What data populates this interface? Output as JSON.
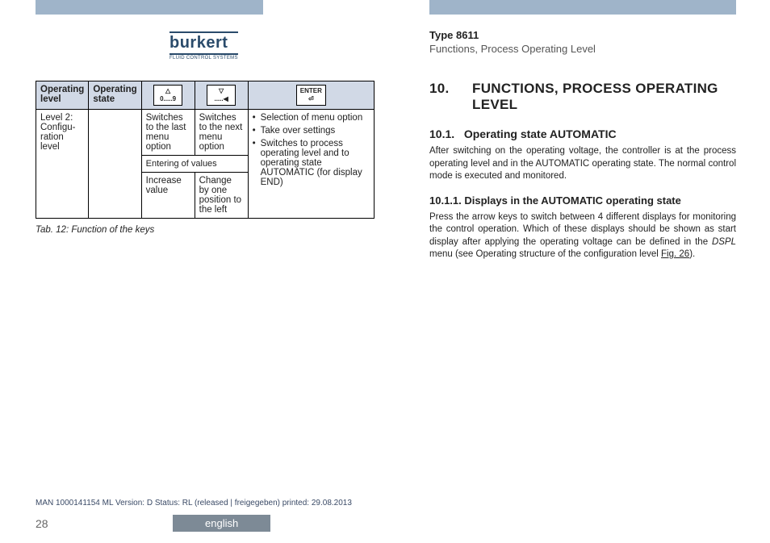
{
  "brand": {
    "name": "burkert",
    "tagline": "FLUID CONTROL SYSTEMS"
  },
  "header": {
    "type": "Type 8611",
    "section": "Functions, Process Operating Level"
  },
  "table": {
    "header": {
      "c0": "Operating level",
      "c1": "Operating state",
      "k1": "△\n0.....9",
      "k2": "▽\n.....◀",
      "k3": "ENTER\n⏎"
    },
    "r0c0": "Level 2: Configu­ration level",
    "r0c1": "",
    "r0c2": "Switches to the last menu option",
    "r0c3": "Switches to the next menu option",
    "r0c4_items": [
      "Selection of menu option",
      "Take over settings",
      "Switches to process operating level and to operating state AUTOMATIC (for display END)"
    ],
    "mid": "Entering of values",
    "r1c2": "Increase value",
    "r1c3": "Change by one position to the left",
    "caption": "Tab. 12:  Function of the keys"
  },
  "right": {
    "num": "10.",
    "title": "FUNCTIONS, PROCESS OPERATING LEVEL",
    "s1num": "10.1.",
    "s1title": "Operating state AUTOMATIC",
    "s1body": "After switching on the operating voltage, the controller is at the process operating level and in the AUTOMATIC operating state. The normal control mode is executed and monitored.",
    "s11num": "10.1.1.",
    "s11title": "Displays in the AUTOMATIC operating state",
    "s11body_a": "Press the arrow keys to switch between 4 different displays for monitoring the control operation. Which of these displays should be shown as start display after applying the operating voltage can be defined in the ",
    "s11body_dspl": "DSPL",
    "s11body_b": " menu (see Operating structure of the configuration level ",
    "s11body_fig": "Fig. 26",
    "s11body_c": ")."
  },
  "footer": {
    "meta": "MAN  1000141154  ML  Version: D Status: RL (released | freigegeben)  printed: 29.08.2013",
    "page": "28",
    "lang": "english"
  }
}
